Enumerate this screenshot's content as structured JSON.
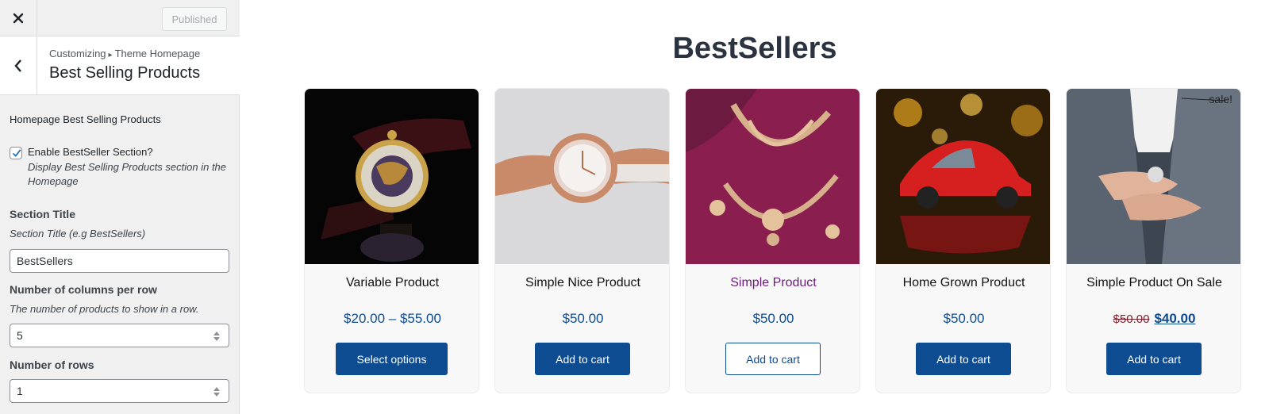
{
  "topbar": {
    "publish_label": "Published"
  },
  "section": {
    "breadcrumb_root": "Customizing",
    "breadcrumb_sep": "▸",
    "breadcrumb_parent": "Theme Homepage",
    "title": "Best Selling Products"
  },
  "panel": {
    "label": "Homepage Best Selling Products",
    "enable": {
      "label": "Enable BestSeller Section?",
      "description": "Display Best Selling Products section in the Homepage",
      "checked": true
    },
    "section_title": {
      "title": "Section Title",
      "description": "Section Title (e.g BestSellers)",
      "value": "BestSellers"
    },
    "columns": {
      "title": "Number of columns per row",
      "description": "The number of products to show in a row.",
      "value": "5"
    },
    "rows": {
      "title": "Number of rows",
      "value": "1"
    }
  },
  "preview": {
    "heading": "BestSellers",
    "products": [
      {
        "name": "Variable Product",
        "price": "$20.00 – $55.00",
        "button": "Select options",
        "image_icon": "pocket-watch"
      },
      {
        "name": "Simple Nice Product",
        "price": "$50.00",
        "button": "Add to cart",
        "image_icon": "rose-gold-watch"
      },
      {
        "name": "Simple Product",
        "price": "$50.00",
        "button": "Add to cart",
        "image_icon": "gold-necklace"
      },
      {
        "name": "Home Grown Product",
        "price": "$50.00",
        "button": "Add to cart",
        "image_icon": "red-toy-car"
      },
      {
        "name": "Simple Product On Sale",
        "price_old": "$50.00",
        "price_new": "$40.00",
        "button": "Add to cart",
        "badge": "sale!",
        "image_icon": "suit-wristwatch"
      }
    ]
  },
  "colors": {
    "accent": "#0e4c92",
    "visited_link": "#6b1b7a",
    "sidebar_bg": "#f0f0f1"
  }
}
